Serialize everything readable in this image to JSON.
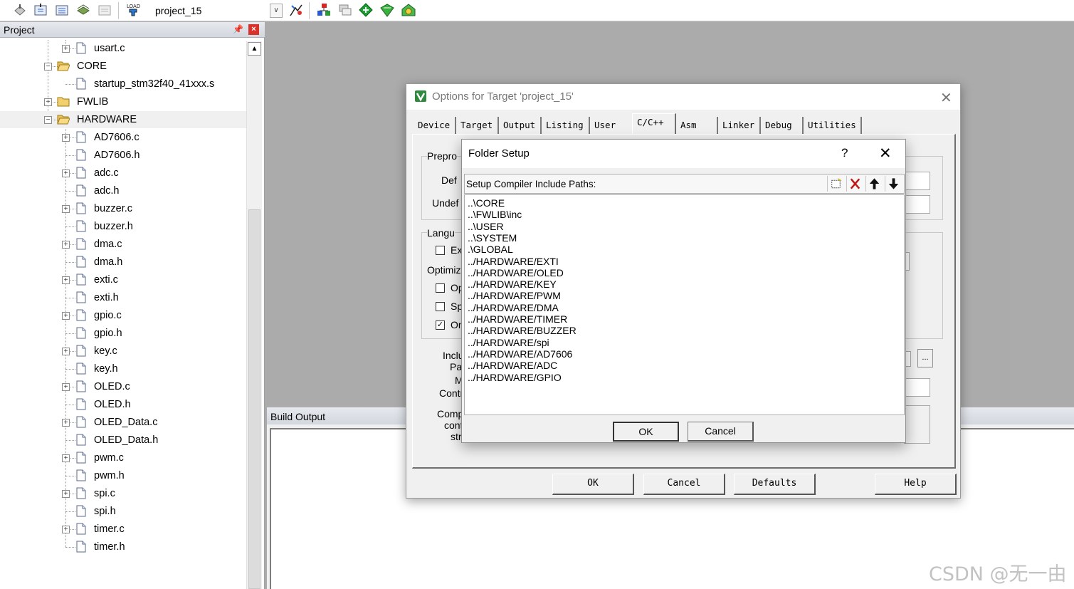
{
  "toolbar": {
    "target_name": "project_15",
    "load_label": "LOAD"
  },
  "project_panel": {
    "title": "Project",
    "tree": [
      {
        "label": "usart.c",
        "kind": "file",
        "depth": 2,
        "expandable": true
      },
      {
        "label": "CORE",
        "kind": "folder",
        "depth": 1,
        "expanded": true
      },
      {
        "label": "startup_stm32f40_41xxx.s",
        "kind": "file",
        "depth": 2,
        "expandable": false
      },
      {
        "label": "FWLIB",
        "kind": "folder",
        "depth": 1,
        "expanded": false
      },
      {
        "label": "HARDWARE",
        "kind": "folder",
        "depth": 1,
        "expanded": true,
        "selected": true
      },
      {
        "label": "AD7606.c",
        "kind": "file",
        "depth": 2,
        "expandable": true
      },
      {
        "label": "AD7606.h",
        "kind": "file",
        "depth": 2,
        "expandable": false
      },
      {
        "label": "adc.c",
        "kind": "file",
        "depth": 2,
        "expandable": true
      },
      {
        "label": "adc.h",
        "kind": "file",
        "depth": 2,
        "expandable": false
      },
      {
        "label": "buzzer.c",
        "kind": "file",
        "depth": 2,
        "expandable": true
      },
      {
        "label": "buzzer.h",
        "kind": "file",
        "depth": 2,
        "expandable": false
      },
      {
        "label": "dma.c",
        "kind": "file",
        "depth": 2,
        "expandable": true
      },
      {
        "label": "dma.h",
        "kind": "file",
        "depth": 2,
        "expandable": false
      },
      {
        "label": "exti.c",
        "kind": "file",
        "depth": 2,
        "expandable": true
      },
      {
        "label": "exti.h",
        "kind": "file",
        "depth": 2,
        "expandable": false
      },
      {
        "label": "gpio.c",
        "kind": "file",
        "depth": 2,
        "expandable": true
      },
      {
        "label": "gpio.h",
        "kind": "file",
        "depth": 2,
        "expandable": false
      },
      {
        "label": "key.c",
        "kind": "file",
        "depth": 2,
        "expandable": true
      },
      {
        "label": "key.h",
        "kind": "file",
        "depth": 2,
        "expandable": false
      },
      {
        "label": "OLED.c",
        "kind": "file",
        "depth": 2,
        "expandable": true
      },
      {
        "label": "OLED.h",
        "kind": "file",
        "depth": 2,
        "expandable": false
      },
      {
        "label": "OLED_Data.c",
        "kind": "file",
        "depth": 2,
        "expandable": true
      },
      {
        "label": "OLED_Data.h",
        "kind": "file",
        "depth": 2,
        "expandable": false
      },
      {
        "label": "pwm.c",
        "kind": "file",
        "depth": 2,
        "expandable": true
      },
      {
        "label": "pwm.h",
        "kind": "file",
        "depth": 2,
        "expandable": false
      },
      {
        "label": "spi.c",
        "kind": "file",
        "depth": 2,
        "expandable": true
      },
      {
        "label": "spi.h",
        "kind": "file",
        "depth": 2,
        "expandable": false
      },
      {
        "label": "timer.c",
        "kind": "file",
        "depth": 2,
        "expandable": true
      },
      {
        "label": "timer.h",
        "kind": "file",
        "depth": 2,
        "expandable": false
      }
    ]
  },
  "build_output": {
    "title": "Build Output"
  },
  "options_dialog": {
    "title": "Options for Target 'project_15'",
    "tabs": [
      "Device",
      "Target",
      "Output",
      "Listing",
      "User",
      "C/C++",
      "Asm",
      "Linker",
      "Debug",
      "Utilities"
    ],
    "active_tab": "C/C++",
    "partial_labels": {
      "preprocessor": "Prepro",
      "define": "Def",
      "undefine": "Undef",
      "language": "Langu",
      "execute": "Ex",
      "optimization": "Optimiz",
      "opt_1": "Op",
      "opt_2": "Sp",
      "opt_3": "On",
      "include_1": "Inclu",
      "include_2": "Pat",
      "misc": "M",
      "controls": "Contr",
      "compiler_1": "Comp",
      "compiler_2": "cont",
      "compiler_3": "stri"
    },
    "dots_label": "...",
    "buttons": {
      "ok": "OK",
      "cancel": "Cancel",
      "defaults": "Defaults",
      "help": "Help"
    }
  },
  "folder_setup": {
    "title": "Folder Setup",
    "help": "?",
    "list_caption": "Setup Compiler Include Paths:",
    "paths": [
      "..\\CORE",
      "..\\FWLIB\\inc",
      "..\\USER",
      "..\\SYSTEM",
      ".\\GLOBAL",
      "../HARDWARE/EXTI",
      "../HARDWARE/OLED",
      "../HARDWARE/KEY",
      "../HARDWARE/PWM",
      "../HARDWARE/DMA",
      "../HARDWARE/TIMER",
      "../HARDWARE/BUZZER",
      "../HARDWARE/spi",
      "../HARDWARE/AD7606",
      "../HARDWARE/ADC",
      "../HARDWARE/GPIO"
    ],
    "ok_label": "OK",
    "cancel_label": "Cancel"
  },
  "watermark": "CSDN @无一由"
}
